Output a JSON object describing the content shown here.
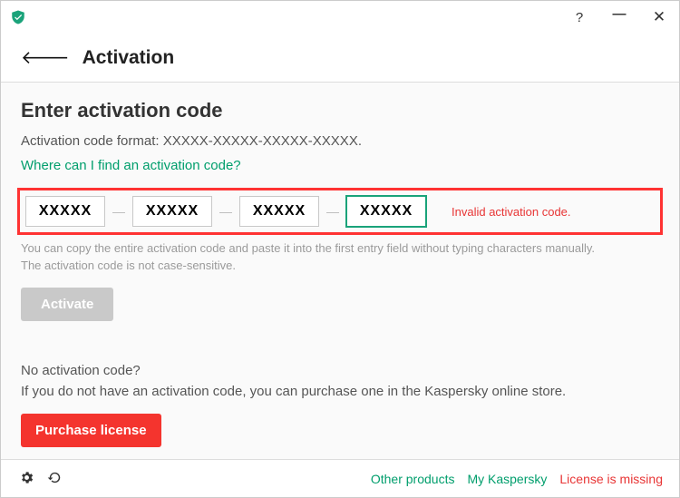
{
  "header": {
    "title": "Activation"
  },
  "content": {
    "heading": "Enter activation code",
    "format_label": "Activation code format: XXXXX-XXXXX-XXXXX-XXXXX.",
    "help_link": "Where can I find an activation code?",
    "code_values": [
      "XXXXX",
      "XXXXX",
      "XXXXX",
      "XXXXX"
    ],
    "invalid_message": "Invalid activation code.",
    "hint_line1": "You can copy the entire activation code and paste it into the first entry field without typing characters manually.",
    "hint_line2": "The activation code is not case-sensitive.",
    "activate_label": "Activate",
    "noact_heading": "No activation code?",
    "noact_sub": "If you do not have an activation code, you can purchase one in the Kaspersky online store.",
    "purchase_label": "Purchase license"
  },
  "footer": {
    "other_products": "Other products",
    "my_kaspersky": "My Kaspersky",
    "license_status": "License is missing"
  },
  "colors": {
    "accent": "#009e6c",
    "danger": "#e83535"
  }
}
